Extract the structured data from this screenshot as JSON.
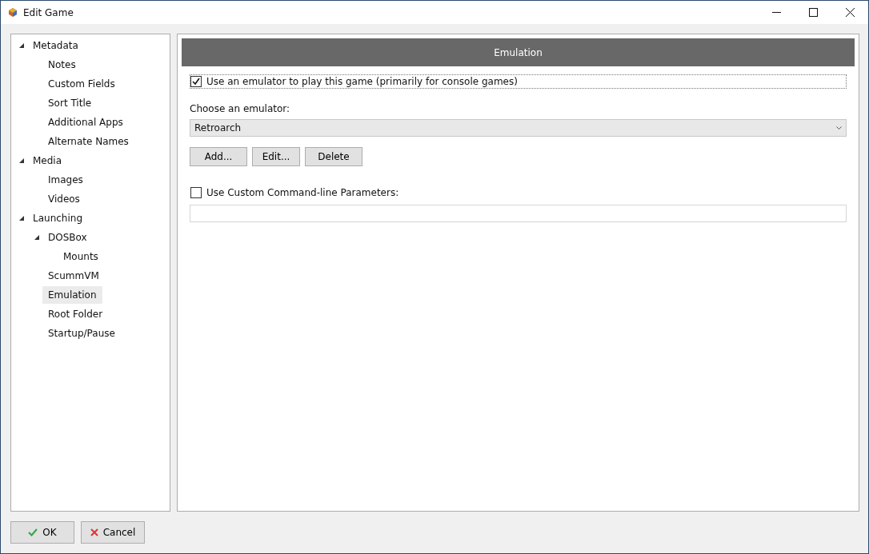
{
  "window": {
    "title": "Edit Game"
  },
  "tree": [
    {
      "label": "Metadata",
      "expanded": true,
      "selected": false,
      "children": [
        {
          "label": "Notes",
          "selected": false
        },
        {
          "label": "Custom Fields",
          "selected": false
        },
        {
          "label": "Sort Title",
          "selected": false
        },
        {
          "label": "Additional Apps",
          "selected": false
        },
        {
          "label": "Alternate Names",
          "selected": false
        }
      ]
    },
    {
      "label": "Media",
      "expanded": true,
      "selected": false,
      "children": [
        {
          "label": "Images",
          "selected": false
        },
        {
          "label": "Videos",
          "selected": false
        }
      ]
    },
    {
      "label": "Launching",
      "expanded": true,
      "selected": false,
      "children": [
        {
          "label": "DOSBox",
          "expanded": true,
          "selected": false,
          "children": [
            {
              "label": "Mounts",
              "selected": false
            }
          ]
        },
        {
          "label": "ScummVM",
          "selected": false
        },
        {
          "label": "Emulation",
          "selected": true
        },
        {
          "label": "Root Folder",
          "selected": false
        },
        {
          "label": "Startup/Pause",
          "selected": false
        }
      ]
    }
  ],
  "panel": {
    "header": "Emulation",
    "use_emulator": {
      "label": "Use an emulator to play this game (primarily for console games)",
      "checked": true
    },
    "emulator_label": "Choose an emulator:",
    "emulator": {
      "value": "Retroarch"
    },
    "buttons": [
      "Add...",
      "Edit...",
      "Delete"
    ],
    "custom_params": {
      "label": "Use Custom Command-line Parameters:",
      "checked": false
    }
  },
  "footer_buttons": [
    {
      "kind": "ok",
      "label": "OK"
    },
    {
      "kind": "cancel",
      "label": "Cancel"
    }
  ]
}
